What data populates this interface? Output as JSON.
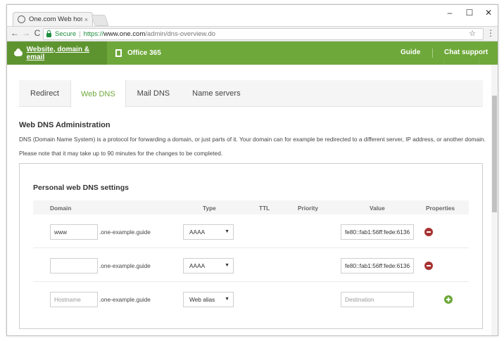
{
  "browser": {
    "tab_title": "One.com Web hosting",
    "tab_close": "×",
    "window_minimize": "–",
    "window_maximize": "☐",
    "window_close": "✕",
    "nav_back": "←",
    "nav_forward": "→",
    "nav_reload": "C",
    "secure_label": "Secure",
    "url_scheme": "https://",
    "url_host": "www.one.com",
    "url_path": "/admin/dns-overview.do",
    "bookmark_star": "☆",
    "menu_dots": "⋮"
  },
  "sitenav": {
    "website_label": "Website, domain & email",
    "office_label": "Office 365",
    "guide_label": "Guide",
    "chat_label": "Chat support"
  },
  "dns_tabs": [
    {
      "label": "Redirect"
    },
    {
      "label": "Web DNS"
    },
    {
      "label": "Mail DNS"
    },
    {
      "label": "Name servers"
    }
  ],
  "active_tab": "Web DNS",
  "page": {
    "title": "Web DNS Administration",
    "desc1": "DNS (Domain Name System) is a protocol for forwarding a domain, or just parts of it. Your domain can for example be redirected to a different server, IP address, or another domain.",
    "desc2": "Please note that it may take up to 90 minutes for the changes to be completed."
  },
  "panel": {
    "title": "Personal web DNS settings",
    "columns": {
      "domain": "Domain",
      "type": "Type",
      "ttl": "TTL",
      "priority": "Priority",
      "value": "Value",
      "properties": "Properties"
    },
    "domain_suffix": ".one-example.guide",
    "caret": "▼",
    "rows": [
      {
        "hostname": "www",
        "type": "AAAA",
        "value": "fe80::fab1:56ff:fede:6136"
      },
      {
        "hostname": "",
        "type": "AAAA",
        "value": "fe80::fab1:56ff:fede:6136"
      }
    ],
    "new_row": {
      "hostname_placeholder": "Hostname",
      "type": "Web alias",
      "value_placeholder": "Destination"
    }
  },
  "colors": {
    "brand_green": "#6ea83a",
    "brand_green_dark": "#5e9430",
    "delete_red": "#a83232"
  }
}
